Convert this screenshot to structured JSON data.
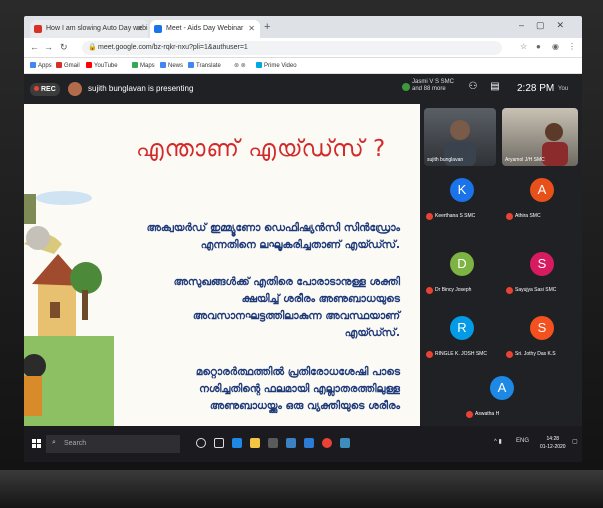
{
  "browser": {
    "tabs": [
      {
        "label": "How I am slowing Auto Day webi",
        "favicon_color": "#d93025"
      },
      {
        "label": "Meet - Aids Day Webinar",
        "favicon_color": "#1a73e8"
      }
    ],
    "url": "meet.google.com/bz-rqkr-nxu?pli=1&authuser=1",
    "bookmarks": [
      "Apps",
      "Gmail",
      "YouTube",
      "Maps",
      "News",
      "Translate",
      "Prime Video"
    ]
  },
  "meet": {
    "rec_label": "REC",
    "presenting_text": "sujith bunglavan is presenting",
    "participants_line1": "Jasmi V S SMC",
    "participants_line2": "and 88 more",
    "time": "2:28 PM",
    "you_label": "You",
    "video_tiles": [
      {
        "name": "sujith bunglavan"
      },
      {
        "name": "Aryamol J/H SMC"
      }
    ],
    "tiles": [
      {
        "initial": "K",
        "name": "Keerthana S SMC",
        "color": "#1a73e8"
      },
      {
        "initial": "A",
        "name": "Athira SMC",
        "color": "#e8501a"
      },
      {
        "initial": "D",
        "name": "Dr Bincy Joseph",
        "color": "#7cb342"
      },
      {
        "initial": "S",
        "name": "Sayujya Sasi SMC",
        "color": "#d81b60"
      },
      {
        "initial": "R",
        "name": "RINGLE K. JOSH SMC",
        "color": "#039be5"
      },
      {
        "initial": "S",
        "name": "Sri. Jothy Das K.S",
        "color": "#f4511e"
      },
      {
        "initial": "A",
        "name": "Aswatha H",
        "color": "#1e88e5"
      }
    ]
  },
  "slide": {
    "title": "എന്താണ് എയ്ഡ്സ് ?",
    "para1": "അക്വയർഡ് ഇമ്മ്യൂണോ ഡെഫിഷ്യൻസി സിൻഡ്രോം എന്നതിനെ ലഘൂകരിച്ചതാണ് എയ്ഡ്സ്.",
    "para2": "അസുഖങ്ങൾക്ക് എതിരെ പോരാടാനുള്ള ശക്തി ക്ഷയിച്ച് ശരീരം അണുബാധയുടെ അവസാനഘട്ടത്തിലാകുന്ന അവസ്ഥയാണ് എയ്ഡ്സ്.",
    "para3": "മറ്റൊരർത്ഥത്തിൽ പ്രതിരോധശേഷി പാടെ നശിച്ചതിന്റെ ഫലമായി എല്ലാതരത്തിലുള്ള അണുബാധയ്ക്കും ഒരു വ്യക്തിയുടെ ശരീരം"
  },
  "taskbar": {
    "search_placeholder": "Search",
    "lang": "ENG",
    "time": "14:28",
    "date": "01-12-2020"
  }
}
